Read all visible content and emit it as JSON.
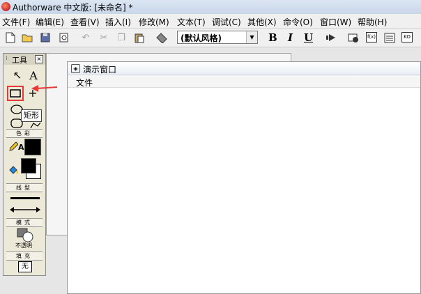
{
  "window": {
    "title": "Authorware 中文版: [未命名] *"
  },
  "menu": {
    "items": [
      "文件(F)",
      "编辑(E)",
      "查看(V)",
      "插入(I)",
      "修改(M)",
      "文本(T)",
      "调试(C)",
      "其他(X)",
      "命令(O)",
      "窗口(W)",
      "帮助(H)"
    ]
  },
  "toolbar": {
    "style_value": "(默认风格)",
    "bold": "B",
    "italic": "I",
    "underline": "U",
    "icons": [
      "new-icon",
      "open-icon",
      "save-all-icon",
      "import-icon",
      "undo-icon",
      "cut-icon",
      "copy-icon",
      "paste-icon",
      "find-icon",
      "restart-icon",
      "control-panel-icon",
      "functions-icon",
      "variables-icon",
      "knowledge-objects-icon"
    ],
    "box_labels": {
      "functions": "f(x)",
      "ko": "KO"
    }
  },
  "tools_panel": {
    "title": "工具",
    "close_glyph": "×",
    "pointer_glyph": "↖",
    "text_tool_glyph": "A",
    "crosshair_glyph": "+",
    "pencil_label": "A",
    "section_color": "色彩",
    "section_line": "线型",
    "section_mode": "模式",
    "section_fill": "填充",
    "mode_value": "不透明",
    "fill_value": "无",
    "tooltip": "矩形"
  },
  "presentation_window": {
    "title": "演示窗口",
    "menu_file": "文件"
  },
  "colors": {
    "highlight": "#e53935",
    "arrow": "#e53935",
    "title_bar": "#dce6f2"
  }
}
